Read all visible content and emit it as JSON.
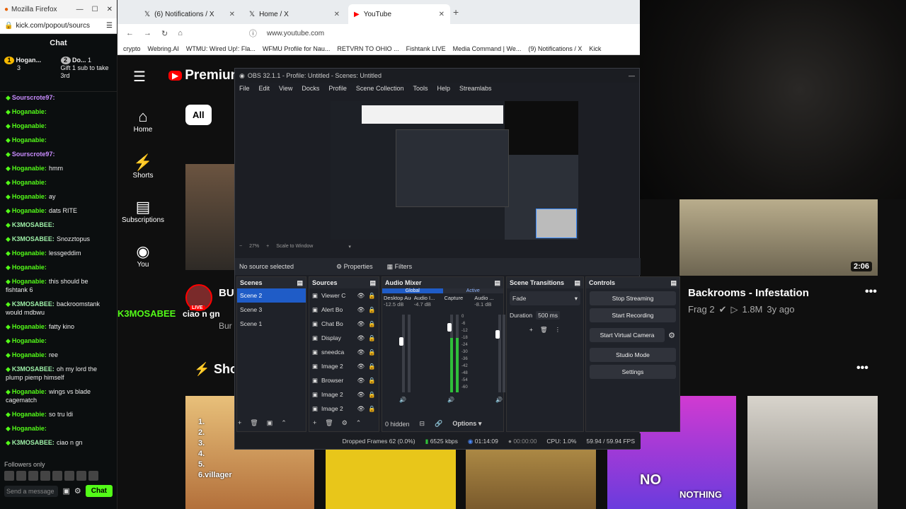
{
  "chat_window": {
    "title": "Mozilla Firefox",
    "url": "kick.com/popout/sourcs",
    "header": "Chat",
    "gifters": [
      {
        "rank": "1",
        "name": "Hogan...",
        "count": "3"
      },
      {
        "rank": "2",
        "name": "Do...",
        "count": "1",
        "note": "Gift 1 sub to take 3rd"
      }
    ],
    "messages": [
      {
        "user": "Sourscrote97:",
        "text": "",
        "color": "purple"
      },
      {
        "user": "Hoganabie:",
        "text": "",
        "color": "green"
      },
      {
        "user": "Hoganabie:",
        "text": "",
        "color": "green"
      },
      {
        "user": "Hoganabie:",
        "text": "",
        "color": "green"
      },
      {
        "user": "Sourscrote97:",
        "text": "",
        "color": "purple"
      },
      {
        "user": "Hoganabie:",
        "text": "hmm",
        "color": "green"
      },
      {
        "user": "Hoganabie:",
        "text": "",
        "color": "green"
      },
      {
        "user": "Hoganabie:",
        "text": "ay",
        "color": "green"
      },
      {
        "user": "Hoganabie:",
        "text": "dats RITE",
        "color": "green"
      },
      {
        "user": "K3MOSABEE:",
        "text": "",
        "color": "k3"
      },
      {
        "user": "K3MOSABEE:",
        "text": "Snozztopus",
        "color": "k3"
      },
      {
        "user": "Hoganabie:",
        "text": "lessgeddim",
        "color": "green"
      },
      {
        "user": "Hoganabie:",
        "text": "",
        "color": "green"
      },
      {
        "user": "Hoganabie:",
        "text": "this should be fishtank 6",
        "color": "green"
      },
      {
        "user": "K3MOSABEE:",
        "text": "backroomstank would mdbwu",
        "color": "k3"
      },
      {
        "user": "Hoganabie:",
        "text": "fatty kino",
        "color": "green"
      },
      {
        "user": "Hoganabie:",
        "text": "",
        "color": "green"
      },
      {
        "user": "Hoganabie:",
        "text": "ree",
        "color": "green"
      },
      {
        "user": "K3MOSABEE:",
        "text": "oh my lord the plump piemp himself",
        "color": "k3"
      },
      {
        "user": "Hoganabie:",
        "text": "wings vs blade cagematch",
        "color": "green"
      },
      {
        "user": "Hoganabie:",
        "text": "so tru ldi",
        "color": "green"
      },
      {
        "user": "Hoganabie:",
        "text": "",
        "color": "green"
      },
      {
        "user": "K3MOSABEE:",
        "text": "ciao n gn",
        "color": "k3"
      }
    ],
    "followers_only": "Followers only",
    "send_placeholder": "Send a message",
    "chat_button": "Chat"
  },
  "browser": {
    "tabs": [
      {
        "label": "(6) Notifications / X",
        "active": false
      },
      {
        "label": "Home / X",
        "active": false
      },
      {
        "label": "YouTube",
        "active": true
      }
    ],
    "url": "www.youtube.com",
    "bookmarks": [
      "crypto",
      "Webring.AI",
      "WTMU: Wired Up!: Fla...",
      "WFMU Profile for Nau...",
      "RETVRN TO OHIO ...",
      "Fishtank LIVE",
      "Media Command | We...",
      "(9) Notifications / X",
      "Kick"
    ],
    "logo": "Premium",
    "chip_all": "All",
    "nav": [
      "Home",
      "Shorts",
      "Subscriptions",
      "You"
    ],
    "live_badge": "LIVE",
    "live_channel": "K3MOSABEE",
    "live_title_partial": "BU",
    "live_sub_partial": "Bur",
    "live_text": "ciao n gn",
    "shorts_partial": "Sho"
  },
  "right_panel": {
    "video_duration": "2:06",
    "video_title": "Backrooms - Infestation",
    "video_channel": "Frag 2",
    "video_views": "1.8M",
    "video_age": "3y ago",
    "short_overlay_1": "NO",
    "short_overlay_2": "NOTHING"
  },
  "ranked_thumb": {
    "lines": [
      "1.",
      "2.",
      "3.",
      "4.",
      "5.",
      "6.villager"
    ]
  },
  "obs": {
    "title": "OBS 32.1.1 - Profile: Untitled - Scenes: Untitled",
    "menu": [
      "File",
      "Edit",
      "View",
      "Docks",
      "Profile",
      "Scene Collection",
      "Tools",
      "Help",
      "Streamlabs"
    ],
    "zoom": "27%",
    "scale_label": "Scale to Window",
    "no_source": "No source selected",
    "properties": "Properties",
    "filters": "Filters",
    "scenes_header": "Scenes",
    "scenes": [
      "Scene 2",
      "Scene 3",
      "Scene 1"
    ],
    "sources_header": "Sources",
    "sources": [
      "Viewer C",
      "Alert Bo",
      "Chat Bo",
      "Display",
      "sneedca",
      "Image 2",
      "Browser",
      "Image 2",
      "Image 2"
    ],
    "mixer_header": "Audio Mixer",
    "mixer_tabs": [
      "Global",
      "Active"
    ],
    "mixer_channels": [
      {
        "name": "Desktop Audio",
        "db": "-12.5 dB"
      },
      {
        "name": "Audio I...",
        "db": "-4.7 dB"
      },
      {
        "name": "Capture",
        "db": ""
      },
      {
        "name": "Audio ...",
        "db": "-8.1 dB"
      }
    ],
    "mixer_scale": [
      "0",
      "-6",
      "-12",
      "-18",
      "-24",
      "-30",
      "-36",
      "-42",
      "-48",
      "-54",
      "-60"
    ],
    "transitions_header": "Scene Transitions",
    "transition": "Fade",
    "duration_label": "Duration",
    "duration_value": "500 ms",
    "controls_header": "Controls",
    "controls": [
      "Stop Streaming",
      "Start Recording",
      "Start Virtual Camera",
      "Studio Mode",
      "Settings"
    ],
    "hidden_count": "0 hidden",
    "options": "Options",
    "status": {
      "dropped": "Dropped Frames 62 (0.0%)",
      "bitrate": "6525 kbps",
      "stream_time": "01:14:09",
      "record_time": "00:00:00",
      "cpu": "CPU: 1.0%",
      "fps": "59.94 / 59.94 FPS"
    }
  }
}
